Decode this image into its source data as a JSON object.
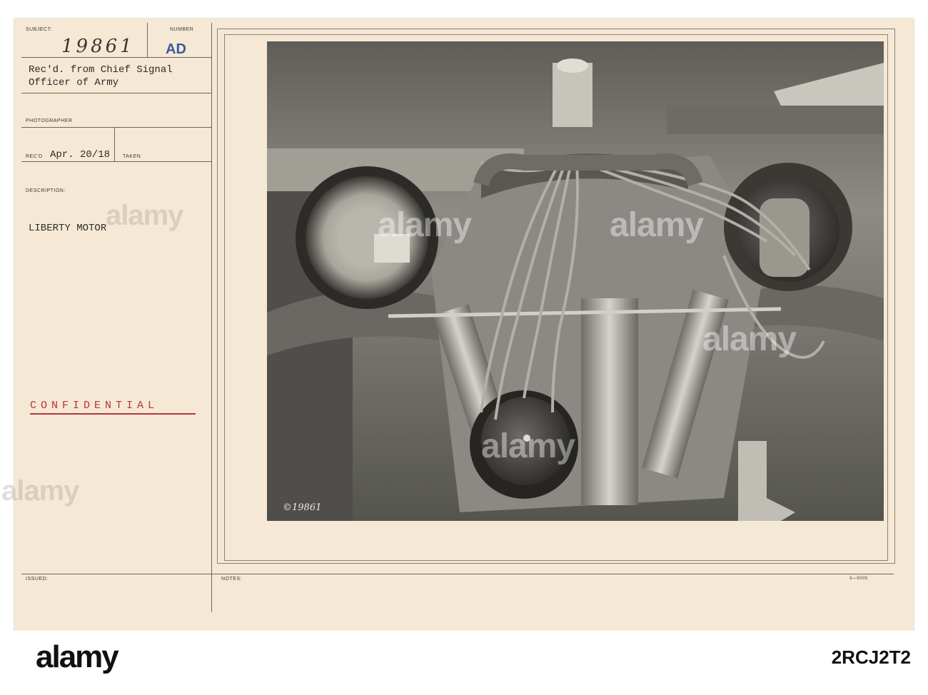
{
  "form": {
    "subject_label": "SUBJECT:",
    "subject_value": "19861",
    "number_label": "NUMBER",
    "number_stamp": "AD",
    "received_from_line1": "Rec'd. from Chief Signal",
    "received_from_line2": "Officer of Army",
    "photographer_label": "PHOTOGRAPHER",
    "recd_label": "REC'D",
    "recd_value": "Apr. 20/18",
    "taken_label": "TAKEN",
    "description_label": "DESCRIPTION:",
    "description_value": "LIBERTY MOTOR",
    "classification": "CONFIDENTIAL",
    "issued_label": "ISSUED:",
    "notes_label": "NOTES:",
    "form_code": "3—5005"
  },
  "photo": {
    "negative_number": "©19861",
    "subject": "Liberty aircraft engine with magnetos and ignition wiring"
  },
  "watermark": {
    "text": "alamy"
  },
  "footer": {
    "logo_text": "alamy",
    "image_id": "2RCJ2T2"
  }
}
